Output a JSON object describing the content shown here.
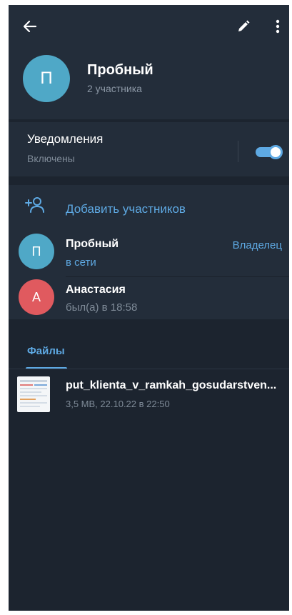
{
  "header": {
    "back_icon": "arrow-left-icon",
    "edit_icon": "pencil-icon",
    "more_icon": "more-vertical-icon",
    "avatar_letter": "П",
    "avatar_color": "#4fa8c7",
    "title": "Пробный",
    "subtitle": "2 участника"
  },
  "notifications": {
    "label": "Уведомления",
    "status": "Включены",
    "toggle_on": true,
    "toggle_color": "#5ea9e3"
  },
  "members": {
    "add_label": "Добавить участников",
    "add_icon": "add-user-icon",
    "list": [
      {
        "letter": "П",
        "avatar_color": "#4fa8c7",
        "name": "Пробный",
        "status": "в сети",
        "role": "Владелец"
      },
      {
        "letter": "А",
        "avatar_color": "#e05a5f",
        "name": "Анастасия",
        "status": "был(а) в 18:58",
        "role": ""
      }
    ]
  },
  "tabs": {
    "files_label": "Файлы"
  },
  "files": [
    {
      "name": "put_klienta_v_ramkah_gosudarstven...",
      "meta": "3,5 MB, 22.10.22 в 22:50",
      "icon": "document-thumbnail-icon"
    }
  ]
}
